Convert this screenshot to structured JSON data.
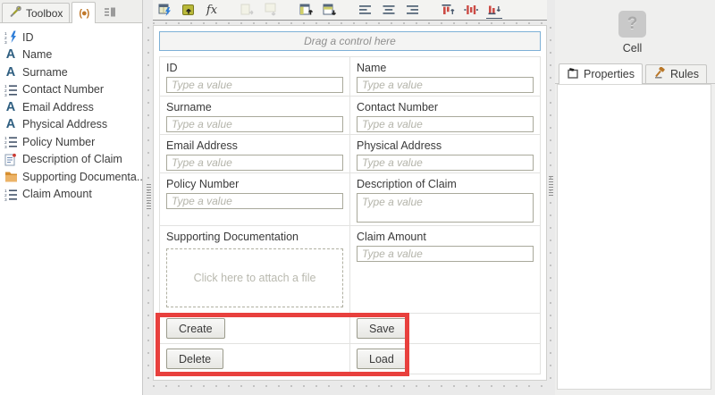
{
  "sidebar": {
    "tabs": [
      {
        "label": "Toolbox",
        "icon": "toolbox-icon"
      },
      {
        "label": "",
        "icon": "context-browser-icon"
      },
      {
        "label": "",
        "icon": "outline-view-icon"
      }
    ],
    "fields": [
      {
        "label": "ID",
        "icon": "autonumber-icon"
      },
      {
        "label": "Name",
        "icon": "text-icon"
      },
      {
        "label": "Surname",
        "icon": "text-icon"
      },
      {
        "label": "Contact Number",
        "icon": "number-icon"
      },
      {
        "label": "Email Address",
        "icon": "text-icon"
      },
      {
        "label": "Physical Address",
        "icon": "text-icon"
      },
      {
        "label": "Policy Number",
        "icon": "number-icon"
      },
      {
        "label": "Description of Claim",
        "icon": "memo-icon"
      },
      {
        "label": "Supporting Documenta...",
        "icon": "folder-icon"
      },
      {
        "label": "Claim Amount",
        "icon": "number-icon"
      }
    ]
  },
  "toolbar": {
    "icons": [
      "generate-view",
      "view-upload",
      "expression-fx",
      "insert-column",
      "insert-row",
      "table-upload",
      "table-download",
      "align-left",
      "align-center",
      "align-right",
      "align-top",
      "distribute-horizontal",
      "align-bottom"
    ]
  },
  "canvas": {
    "drop_hint": "Drag a control here",
    "placeholder_text": "Type a value",
    "attach_hint": "Click here to attach a file",
    "fields": [
      {
        "label": "ID"
      },
      {
        "label": "Name"
      },
      {
        "label": "Surname"
      },
      {
        "label": "Contact Number"
      },
      {
        "label": "Email Address"
      },
      {
        "label": "Physical Address"
      },
      {
        "label": "Policy Number"
      },
      {
        "label": "Description of Claim"
      },
      {
        "label": "Supporting Documentation"
      },
      {
        "label": "Claim Amount"
      }
    ],
    "buttons": {
      "create": "Create",
      "save": "Save",
      "delete": "Delete",
      "load": "Load"
    }
  },
  "inspector": {
    "selected_control_type": "Cell",
    "help_glyph": "?",
    "tabs": [
      {
        "label": "Properties",
        "active": true
      },
      {
        "label": "Rules",
        "active": false
      }
    ]
  },
  "colors": {
    "annotation_red": "#e8403d",
    "drop_target_blue": "#7db0d6",
    "folder_orange": "#e09b3c",
    "text_icon_blue": "#2e5e80",
    "rules_gavel_orange": "#b97728"
  }
}
